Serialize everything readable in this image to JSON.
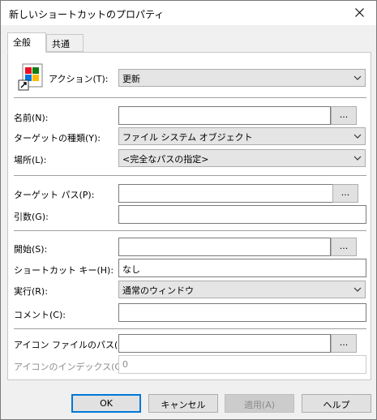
{
  "window": {
    "title": "新しいショートカットのプロパティ"
  },
  "tabs": [
    {
      "label": "全般"
    },
    {
      "label": "共通"
    }
  ],
  "action": {
    "label": "アクション(T):",
    "value": "更新"
  },
  "name": {
    "label": "名前(N):",
    "value": "",
    "browse": "..."
  },
  "target_type": {
    "label": "ターゲットの種類(Y):",
    "value": "ファイル システム オブジェクト"
  },
  "location": {
    "label": "場所(L):",
    "value": "<完全なパスの指定>"
  },
  "target_path": {
    "label": "ターゲット パス(P):",
    "value": "",
    "browse": "..."
  },
  "arguments": {
    "label": "引数(G):",
    "value": ""
  },
  "start_in": {
    "label": "開始(S):",
    "value": "",
    "browse": "..."
  },
  "shortcut_key": {
    "label": "ショートカット キー(H):",
    "value": "なし"
  },
  "run": {
    "label": "実行(R):",
    "value": "通常のウィンドウ"
  },
  "comment": {
    "label": "コメント(C):",
    "value": ""
  },
  "icon_path": {
    "label": "アイコン ファイルのパス(I):",
    "value": "",
    "browse": "..."
  },
  "icon_index": {
    "label": "アイコンのインデックス(O):",
    "value": "0"
  },
  "buttons": {
    "ok": "OK",
    "cancel": "キャンセル",
    "apply": "適用(A)",
    "help": "ヘルプ"
  },
  "colors": {
    "accent": "#0078d7",
    "disabled_text": "#8c8c8c"
  }
}
